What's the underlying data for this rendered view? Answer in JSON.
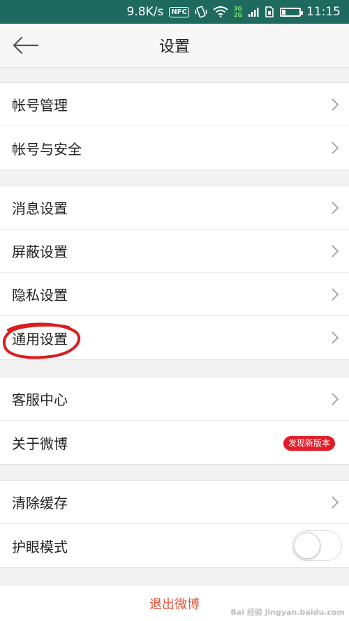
{
  "status_bar": {
    "speed": "9.8K/s",
    "nfc": "NFC",
    "net_top": "3G",
    "net_bottom": "2G",
    "time": "11:15"
  },
  "header": {
    "title": "设置"
  },
  "groups": [
    {
      "items": [
        {
          "label": "帐号管理"
        },
        {
          "label": "帐号与安全"
        }
      ]
    },
    {
      "items": [
        {
          "label": "消息设置"
        },
        {
          "label": "屏蔽设置"
        },
        {
          "label": "隐私设置"
        },
        {
          "label": "通用设置"
        }
      ]
    },
    {
      "items": [
        {
          "label": "客服中心"
        },
        {
          "label": "关于微博",
          "badge": "发现新版本"
        }
      ]
    },
    {
      "items": [
        {
          "label": "清除缓存"
        },
        {
          "label": "护眼模式",
          "toggle": false
        }
      ]
    }
  ],
  "logout": {
    "label": "退出微博"
  },
  "watermark": "Bai 经验 jingyan.baidu.com",
  "colors": {
    "status_bar": "#1e6a5e",
    "badge": "#e21d2b",
    "logout": "#e0533a",
    "annotation_circle": "#d81e1e"
  }
}
